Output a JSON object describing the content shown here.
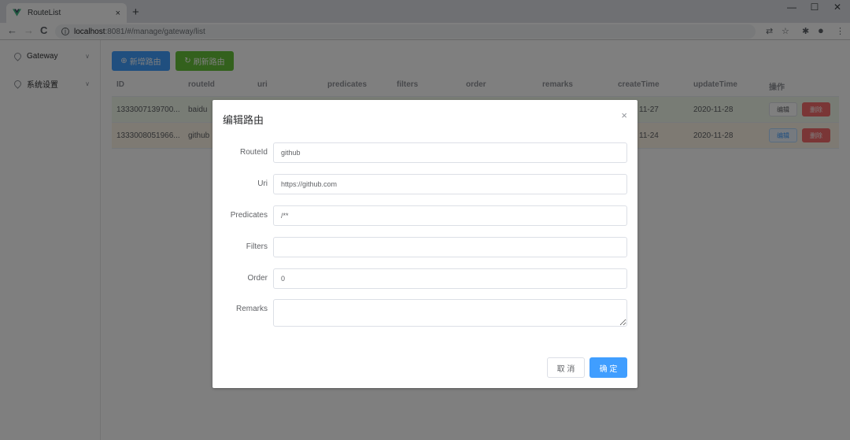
{
  "browser": {
    "tab_title": "RouteList",
    "tab_close": "×",
    "new_tab": "+",
    "url_host": "localhost",
    "url_path": ":8081/#/manage/gateway/list",
    "window_controls": {
      "minimize": "—",
      "maximize": "☐",
      "close": "✕"
    },
    "nav": {
      "back": "←",
      "forward": "→",
      "reload": "C"
    },
    "icons": {
      "translate": "⇄",
      "star": "☆",
      "extensions": "✱",
      "profile": "●",
      "menu": "⋮"
    }
  },
  "sidebar": {
    "items": [
      {
        "label": "Gateway",
        "icon": "location-icon",
        "chevron": "∨"
      },
      {
        "label": "系统设置",
        "icon": "location-icon",
        "chevron": "∨"
      }
    ]
  },
  "toolbar": {
    "add_label": "新增路由",
    "refresh_label": "刷新路由",
    "add_icon": "⊕",
    "refresh_icon": "↻"
  },
  "table": {
    "columns": [
      "ID",
      "routeId",
      "uri",
      "predicates",
      "filters",
      "order",
      "remarks",
      "createTime",
      "updateTime",
      "操作"
    ],
    "rows": [
      {
        "id": "1333007139700...",
        "routeId": "baidu",
        "createTime": "11-27",
        "updateTime": "2020-11-28",
        "edit": "编辑",
        "delete": "删除"
      },
      {
        "id": "1333008051966...",
        "routeId": "github",
        "createTime": "11-24",
        "updateTime": "2020-11-28",
        "edit": "编辑",
        "delete": "删除"
      }
    ]
  },
  "dialog": {
    "title": "编辑路由",
    "close": "×",
    "fields": {
      "routeId": {
        "label": "RouteId",
        "value": "github"
      },
      "uri": {
        "label": "Uri",
        "value": "https://github.com"
      },
      "predicates": {
        "label": "Predicates",
        "value": "/**"
      },
      "filters": {
        "label": "Filters",
        "value": ""
      },
      "order": {
        "label": "Order",
        "value": "0"
      },
      "remarks": {
        "label": "Remarks",
        "value": ""
      }
    },
    "cancel_label": "取 消",
    "ok_label": "确 定"
  },
  "colors": {
    "primary": "#409eff",
    "success": "#67c23a",
    "danger": "#f56c6c",
    "row_success": "#f0f9eb",
    "row_warning": "#fdf5e6"
  }
}
